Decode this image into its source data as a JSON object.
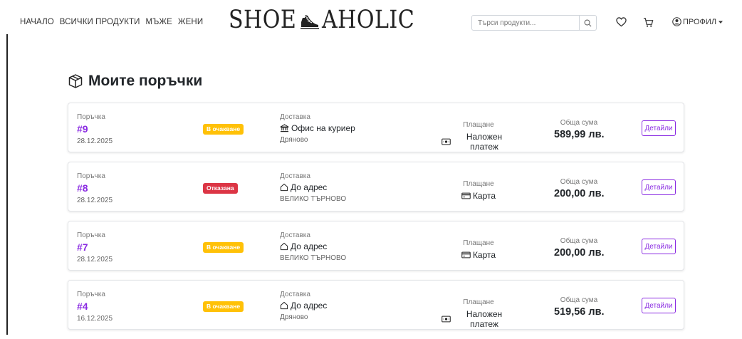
{
  "nav": {
    "items": [
      {
        "id": "home",
        "label": "НАЧАЛО"
      },
      {
        "id": "all",
        "label": "ВСИЧКИ ПРОДУКТИ"
      },
      {
        "id": "men",
        "label": "МЪЖЕ"
      },
      {
        "id": "women",
        "label": "ЖЕНИ"
      }
    ]
  },
  "logo": {
    "left": "SHOE",
    "right": "AHOLIC"
  },
  "search": {
    "placeholder": "Търси продукти..."
  },
  "profile": {
    "label": "ПРОФИЛ"
  },
  "page": {
    "title": "Моите поръчки"
  },
  "labels": {
    "order": "Поръчка",
    "delivery": "Доставка",
    "payment": "Плащане",
    "total": "Обща сума",
    "details": "Детайли"
  },
  "orders": [
    {
      "number": "#9",
      "date": "28.12.2025",
      "status": "В очакване",
      "status_type": "pending",
      "delivery_icon": "bank-icon",
      "delivery_method": "Офис на куриер",
      "city": "Дряново",
      "payment_icon": "cash-icon",
      "payment": "Наложен платеж",
      "total": "589,99 лв."
    },
    {
      "number": "#8",
      "date": "28.12.2025",
      "status": "Отказана",
      "status_type": "cancelled",
      "delivery_icon": "house-icon",
      "delivery_method": "До адрес",
      "city": "ВЕЛИКО ТЪРНОВО",
      "payment_icon": "credit-card-icon",
      "payment": "Карта",
      "total": "200,00 лв."
    },
    {
      "number": "#7",
      "date": "28.12.2025",
      "status": "В очакване",
      "status_type": "pending",
      "delivery_icon": "house-icon",
      "delivery_method": "До адрес",
      "city": "ВЕЛИКО ТЪРНОВО",
      "payment_icon": "credit-card-icon",
      "payment": "Карта",
      "total": "200,00 лв."
    },
    {
      "number": "#4",
      "date": "16.12.2025",
      "status": "В очакване",
      "status_type": "pending",
      "delivery_icon": "house-icon",
      "delivery_method": "До адрес",
      "city": "Дряново",
      "payment_icon": "cash-icon",
      "payment": "Наложен платеж",
      "total": "519,56 лв."
    }
  ],
  "colors": {
    "accent": "#8a2be2",
    "pending": "#ffc107",
    "cancelled": "#dc3545"
  }
}
